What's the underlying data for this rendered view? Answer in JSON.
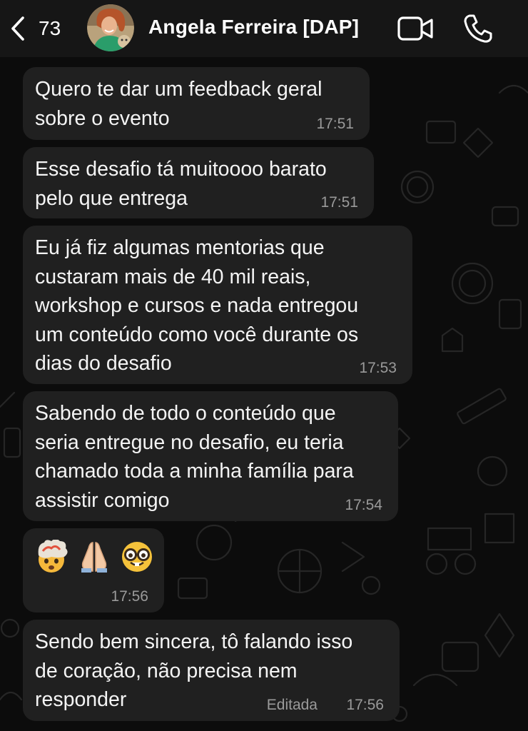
{
  "header": {
    "back_count": "73",
    "contact_name": "Angela Ferreira [DAP]",
    "icons": [
      "chevron-left-icon",
      "video-camera-icon",
      "phone-icon"
    ]
  },
  "messages": [
    {
      "text": "Quero te dar um feedback geral\nsobre o evento",
      "time": "17:51"
    },
    {
      "text": "Esse desafio tá muitoooo barato\npelo que entrega",
      "time": "17:51"
    },
    {
      "text": "Eu já fiz algumas mentorias que\ncustaram mais de 40 mil reais,\nworkshop e cursos e nada entregou\num conteúdo como você durante os\ndias do desafio",
      "time": "17:53"
    },
    {
      "text": "Sabendo de todo o conteúdo que\nseria entregue no desafio, eu teria\nchamado toda a minha família para\nassistir comigo",
      "time": "17:54"
    },
    {
      "emojis": [
        "exploding-head-emoji",
        "folded-hands-emoji",
        "nerd-face-emoji"
      ],
      "time": "17:56"
    },
    {
      "text": "Sendo bem sincera, tô falando isso\nde coração, não precisa nem\nresponder",
      "time": "17:56",
      "edited": "Editada"
    }
  ],
  "colors": {
    "background": "#0c0c0c",
    "header": "#161616",
    "bubble": "#202020",
    "text": "#f4f4f4",
    "timestamp": "#9a9a9a"
  }
}
